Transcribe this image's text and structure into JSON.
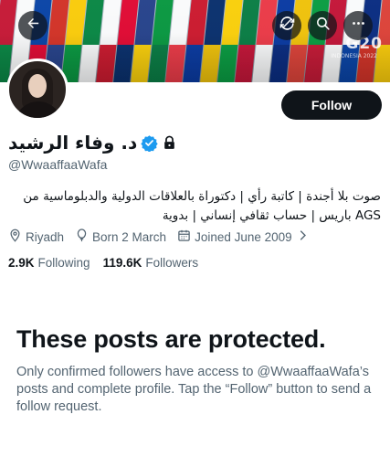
{
  "banner": {
    "logo_text": "G20",
    "logo_subtext": "INDONESIA 2022",
    "flag_colors": [
      "#c8102e",
      "#ffffff",
      "#003da5",
      "#d52b1e",
      "#ffcd00",
      "#00843d",
      "#ffffff",
      "#e4002b",
      "#1f3c88",
      "#009639",
      "#ffffff",
      "#ce1126",
      "#002868",
      "#ffd100",
      "#007a3d",
      "#ef3340",
      "#0033a0",
      "#f4c300",
      "#009b3a",
      "#c60c30",
      "#ffffff",
      "#00247d",
      "#e03c31"
    ]
  },
  "top_bar": {
    "back_icon": "arrow-left-icon",
    "refresh_icon": "refresh-icon",
    "search_icon": "search-icon",
    "more_icon": "more-horizontal-icon"
  },
  "profile": {
    "display_name": "د. وفاء الرشيد",
    "handle": "@WwaaffaaWafa",
    "verified_color": "#1d9bf0",
    "bio": "صوت بلا أجندة | كاتبة رأي | دكتوراة بالعلاقات الدولية والدبلوماسية من AGS باريس | حساب ثقافي إنساني | بدوية",
    "location": "Riyadh",
    "birth": "Born 2 March",
    "joined": "Joined June 2009"
  },
  "actions": {
    "follow_label": "Follow"
  },
  "stats": {
    "following_count": "2.9K",
    "following_label": "Following",
    "followers_count": "119.6K",
    "followers_label": "Followers"
  },
  "protected": {
    "title": "These posts are protected.",
    "message": "Only confirmed followers have access to @WwaaffaaWafa’s posts and complete profile. Tap the “Follow” button to send a follow request."
  }
}
